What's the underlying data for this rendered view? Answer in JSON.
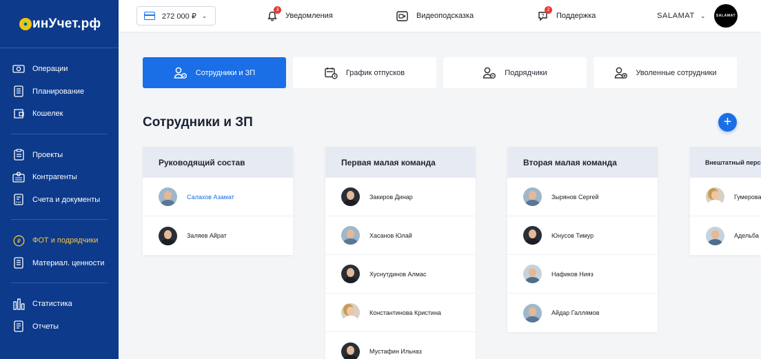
{
  "brand": {
    "logo_text": "инУчет.рф"
  },
  "sidebar": {
    "groups": [
      [
        {
          "label": "Операции",
          "icon": "operations-icon"
        },
        {
          "label": "Планирование",
          "icon": "planning-icon"
        },
        {
          "label": "Кошелек",
          "icon": "wallet-icon"
        }
      ],
      [
        {
          "label": "Проекты",
          "icon": "projects-icon"
        },
        {
          "label": "Контрагенты",
          "icon": "contractors-icon"
        },
        {
          "label": "Счета и документы",
          "icon": "invoices-icon"
        }
      ],
      [
        {
          "label": "ФОТ и подрядчики",
          "icon": "payroll-icon",
          "active": true
        },
        {
          "label": "Материал. ценности",
          "icon": "materials-icon"
        }
      ],
      [
        {
          "label": "Статистика",
          "icon": "statistics-icon"
        },
        {
          "label": "Отчеты",
          "icon": "reports-icon"
        }
      ]
    ]
  },
  "topbar": {
    "balance": "272 000 ₽",
    "notifications": {
      "label": "Уведомления",
      "count": "3"
    },
    "video_hint": {
      "label": "Видеоподсказка"
    },
    "support": {
      "label": "Поддержка",
      "count": "2"
    },
    "user": {
      "name": "SALAMAT",
      "avatar_text": "SALAMAT"
    }
  },
  "tabs": [
    {
      "label": "Сотрудники и ЗП",
      "active": true
    },
    {
      "label": "График отпусков"
    },
    {
      "label": "Подрядчики"
    },
    {
      "label": "Уволенные сотрудники"
    }
  ],
  "page_title": "Сотрудники и ЗП",
  "add_button": "+",
  "teams": [
    {
      "title": "Руководящий состав",
      "members": [
        {
          "name": "Салахов Азамат",
          "link": true,
          "photo": "m1"
        },
        {
          "name": "Заляев Айрат",
          "photo": "m2"
        }
      ]
    },
    {
      "title": "Первая малая команда",
      "members": [
        {
          "name": "Закиров Динар",
          "photo": "m2"
        },
        {
          "name": "Хасанов Юлай",
          "photo": "m1"
        },
        {
          "name": "Хуснутдинов Алмас",
          "photo": "m2"
        },
        {
          "name": "Константинова Кристина",
          "photo": "f1"
        },
        {
          "name": "Мустафин Ильназ",
          "photo": "m2"
        }
      ]
    },
    {
      "title": "Вторая малая команда",
      "members": [
        {
          "name": "Зырянов Сергей",
          "photo": "m1"
        },
        {
          "name": "Юнусов Тимур",
          "photo": "m2"
        },
        {
          "name": "Нафиков Нияз",
          "photo": "m3"
        },
        {
          "name": "Айдар Галлямов",
          "photo": "m1"
        }
      ]
    },
    {
      "title": "Внештатный персонал",
      "members": [
        {
          "name": "Гумерова",
          "photo": "f1"
        },
        {
          "name": "Адельба",
          "photo": "m3"
        }
      ]
    }
  ],
  "colors": {
    "sidebar": "#0d3a8a",
    "accent": "#1a6fe6",
    "active_nav": "#f5c842",
    "badge": "#e53935"
  }
}
